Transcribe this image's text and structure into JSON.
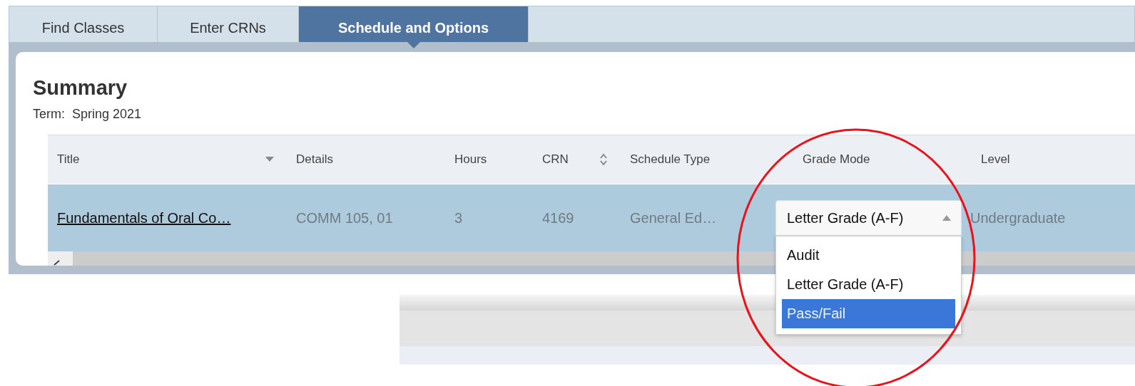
{
  "tabs": [
    {
      "label": "Find Classes",
      "selected": false
    },
    {
      "label": "Enter CRNs",
      "selected": false
    },
    {
      "label": "Schedule and Options",
      "selected": true
    }
  ],
  "summary": {
    "title": "Summary",
    "term": "Term:  Spring 2021"
  },
  "table": {
    "columns": [
      {
        "label": "Title",
        "sorted_descending": true
      },
      {
        "label": "Details"
      },
      {
        "label": "Hours"
      },
      {
        "label": "CRN",
        "sortable": true
      },
      {
        "label": "Schedule Type"
      },
      {
        "label": "Grade Mode"
      },
      {
        "label": "Level"
      }
    ],
    "rows": [
      {
        "title": "Fundamentals of Oral Co…",
        "details": "COMM 105, 01",
        "hours": "3",
        "crn": "4169",
        "schedule_type": "General Ed…",
        "grade_mode": {
          "value": "Letter Grade (A-F)",
          "expanded": true,
          "options": [
            {
              "label": "Audit",
              "highlighted": false
            },
            {
              "label": "Letter Grade (A-F)",
              "highlighted": false
            },
            {
              "label": "Pass/Fail",
              "highlighted": true
            }
          ]
        },
        "level": "Undergraduate"
      }
    ]
  }
}
